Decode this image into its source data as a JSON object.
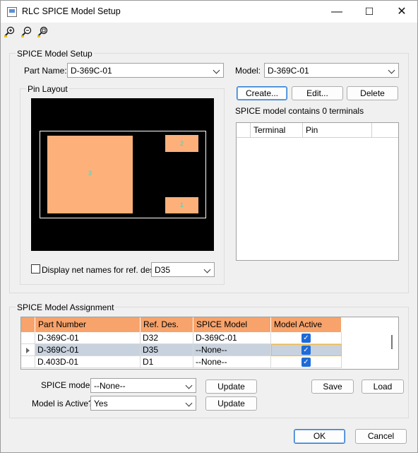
{
  "window": {
    "title": "RLC SPICE Model Setup",
    "minimize": "—",
    "maximize": "☐",
    "close": "✕"
  },
  "toolbar": {
    "zoom_icons": [
      "zoom-in-icon",
      "zoom-out-icon",
      "zoom-fit-icon"
    ]
  },
  "setup": {
    "group_label": "SPICE Model Setup",
    "part_name_label": "Part Name:",
    "part_name_value": "D-369C-01",
    "model_label": "Model:",
    "model_value": "D-369C-01",
    "create_label": "Create...",
    "edit_label": "Edit...",
    "delete_label": "Delete",
    "terminal_count_text": "SPICE model contains 0 terminals",
    "terminal_columns": [
      "Terminal",
      "Pin"
    ],
    "pin_layout_label": "Pin Layout",
    "pads": [
      "3",
      "2",
      "1"
    ],
    "display_net_label": "Display net names for ref. des.",
    "display_net_checked": false,
    "ref_des_value": "D35"
  },
  "assignment": {
    "group_label": "SPICE Model Assignment",
    "columns": [
      "Part Number",
      "Ref. Des.",
      "SPICE Model",
      "Model Active"
    ],
    "rows": [
      {
        "part": "D-369C-01",
        "ref": "D32",
        "model": "D-369C-01",
        "active": true,
        "current": false
      },
      {
        "part": "D-369C-01",
        "ref": "D35",
        "model": "--None--",
        "active": true,
        "current": true
      },
      {
        "part": "D.403D-01",
        "ref": "D1",
        "model": "--None--",
        "active": true,
        "current": false
      }
    ],
    "spice_model_label": "SPICE model:",
    "spice_model_value": "--None--",
    "active_label": "Model is Active?",
    "active_value": "Yes",
    "update_label": "Update",
    "save_label": "Save",
    "load_label": "Load"
  },
  "footer": {
    "ok_label": "OK",
    "cancel_label": "Cancel"
  },
  "colors": {
    "header_accent": "#f7a36b",
    "pad": "#fdb07a",
    "pad_number": "#28e0d6",
    "selected_row": "#f6b93b"
  }
}
